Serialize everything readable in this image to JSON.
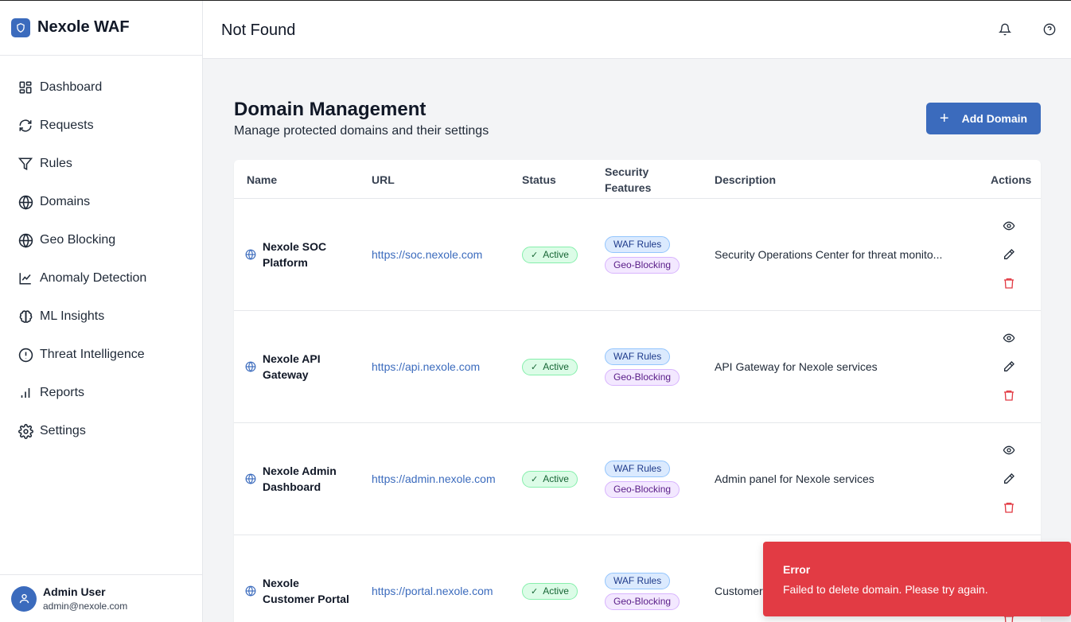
{
  "app": {
    "name": "Nexole WAF"
  },
  "header": {
    "title": "Not Found"
  },
  "sidebar": {
    "items": [
      {
        "label": "Dashboard",
        "icon": "dashboard-icon"
      },
      {
        "label": "Requests",
        "icon": "refresh-icon"
      },
      {
        "label": "Rules",
        "icon": "filter-icon"
      },
      {
        "label": "Domains",
        "icon": "globe-icon"
      },
      {
        "label": "Geo Blocking",
        "icon": "globe-icon"
      },
      {
        "label": "Anomaly Detection",
        "icon": "line-chart-icon"
      },
      {
        "label": "ML Insights",
        "icon": "brain-icon"
      },
      {
        "label": "Threat Intelligence",
        "icon": "alert-circle-icon"
      },
      {
        "label": "Reports",
        "icon": "bar-chart-icon"
      },
      {
        "label": "Settings",
        "icon": "gear-icon"
      }
    ]
  },
  "user": {
    "name": "Admin User",
    "email": "admin@nexole.com"
  },
  "page": {
    "title": "Domain Management",
    "subtitle": "Manage protected domains and their settings",
    "add_button": "Add Domain"
  },
  "table": {
    "columns": {
      "name": "Name",
      "url": "URL",
      "status": "Status",
      "features_1": "Security",
      "features_2": "Features",
      "description": "Description",
      "actions": "Actions"
    },
    "rows": [
      {
        "name_1": "Nexole SOC",
        "name_2": "Platform",
        "url": "https://soc.nexole.com",
        "status": "Active",
        "feature_1": "WAF Rules",
        "feature_2": "Geo-Blocking",
        "description": "Security Operations Center for threat monito..."
      },
      {
        "name_1": "Nexole API",
        "name_2": "Gateway",
        "url": "https://api.nexole.com",
        "status": "Active",
        "feature_1": "WAF Rules",
        "feature_2": "Geo-Blocking",
        "description": "API Gateway for Nexole services"
      },
      {
        "name_1": "Nexole Admin",
        "name_2": "Dashboard",
        "url": "https://admin.nexole.com",
        "status": "Active",
        "feature_1": "WAF Rules",
        "feature_2": "Geo-Blocking",
        "description": "Admin panel for Nexole services"
      },
      {
        "name_1": "Nexole",
        "name_2": "Customer Portal",
        "url": "https://portal.nexole.com",
        "status": "Active",
        "feature_1": "WAF Rules",
        "feature_2": "Geo-Blocking",
        "description": "Customer"
      }
    ]
  },
  "toast": {
    "title": "Error",
    "message": "Failed to delete domain. Please try again."
  },
  "colors": {
    "brand": "#3b6bbd",
    "error": "#e23b44",
    "active_bg": "#dcfce7",
    "link": "#3b6bbd"
  }
}
